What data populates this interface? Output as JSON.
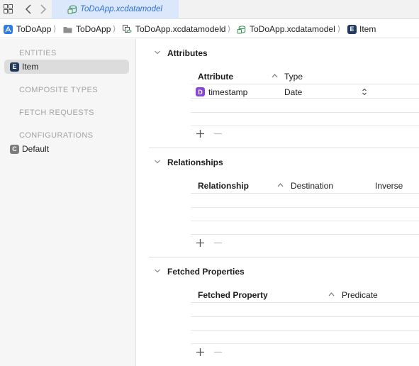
{
  "tabbar": {
    "active_tab": "ToDoApp.xcdatamodel",
    "grid_icon": "grid-icon",
    "back_icon": "chevron-left-icon",
    "forward_icon": "chevron-right-icon"
  },
  "breadcrumb": {
    "items": [
      {
        "label": "ToDoApp",
        "icon": "app-project-icon"
      },
      {
        "label": "ToDoApp",
        "icon": "folder-icon"
      },
      {
        "label": "ToDoApp.xcdatamodeld",
        "icon": "datamodel-bundle-icon"
      },
      {
        "label": "ToDoApp.xcdatamodel",
        "icon": "datamodel-icon"
      },
      {
        "label": "Item",
        "icon": "entity-icon"
      }
    ]
  },
  "sidebar": {
    "entities_header": "ENTITIES",
    "entity_badge": "E",
    "entity_item": "Item",
    "composite_header": "COMPOSITE TYPES",
    "fetch_header": "FETCH REQUESTS",
    "config_header": "CONFIGURATIONS",
    "config_badge": "C",
    "config_item": "Default"
  },
  "attributes": {
    "title": "Attributes",
    "col_attribute": "Attribute",
    "col_type": "Type",
    "rows": [
      {
        "badge": "D",
        "name": "timestamp",
        "type": "Date"
      }
    ]
  },
  "relationships": {
    "title": "Relationships",
    "col_relationship": "Relationship",
    "col_destination": "Destination",
    "col_inverse": "Inverse"
  },
  "fetched_properties": {
    "title": "Fetched Properties",
    "col_property": "Fetched Property",
    "col_predicate": "Predicate"
  },
  "colors": {
    "accent": "#2f6fd6",
    "tab_highlight": "#dbe8fb",
    "entity_badge": "#223a5e",
    "date_badge": "#8b45d8"
  }
}
